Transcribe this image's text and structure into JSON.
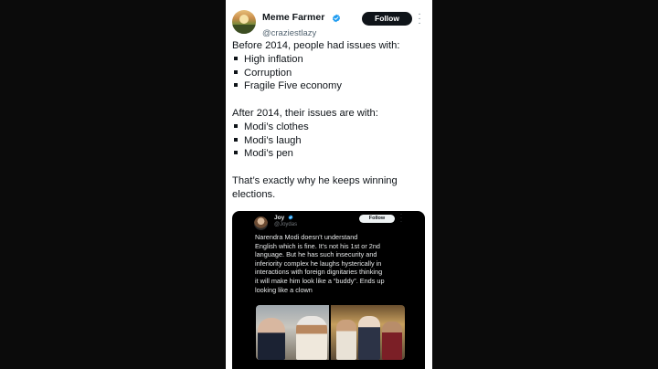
{
  "tweet": {
    "author": {
      "name": "Meme Farmer",
      "handle": "@craziestlazy",
      "verified_icon": "verified-badge-icon",
      "avatar_icon": "profile-avatar"
    },
    "follow_label": "Follow",
    "more_icon": "more-options-icon",
    "text": {
      "intro_before": "Before 2014, people had issues with:",
      "before_items": [
        "High inflation",
        "Corruption",
        "Fragile Five economy"
      ],
      "intro_after": "After 2014, their issues are with:",
      "after_items": [
        "Modi’s clothes",
        "Modi’s laugh",
        "Modi’s pen"
      ],
      "closing_line1": "That’s exactly why he keeps winning",
      "closing_line2": "elections."
    }
  },
  "quoted_tweet": {
    "author": {
      "name": "Joy",
      "handle": "@Joydas"
    },
    "follow_label": "Follow",
    "text_lines": [
      "Narendra Modi doesn’t understand",
      "English which is fine. It’s not his 1st or 2nd",
      "language. But he has such insecurity and",
      "inferiority complex he laughs hysterically in",
      "interactions with foreign dignitaries thinking",
      "it will make him look like a “buddy”. Ends up",
      "looking like a clown"
    ]
  },
  "colors": {
    "page_background": "#0b0b0b",
    "card_background": "#ffffff",
    "text_primary": "#0f1419",
    "text_secondary": "#536471",
    "verified_blue": "#1d9bf0",
    "quote_background": "#000000"
  }
}
